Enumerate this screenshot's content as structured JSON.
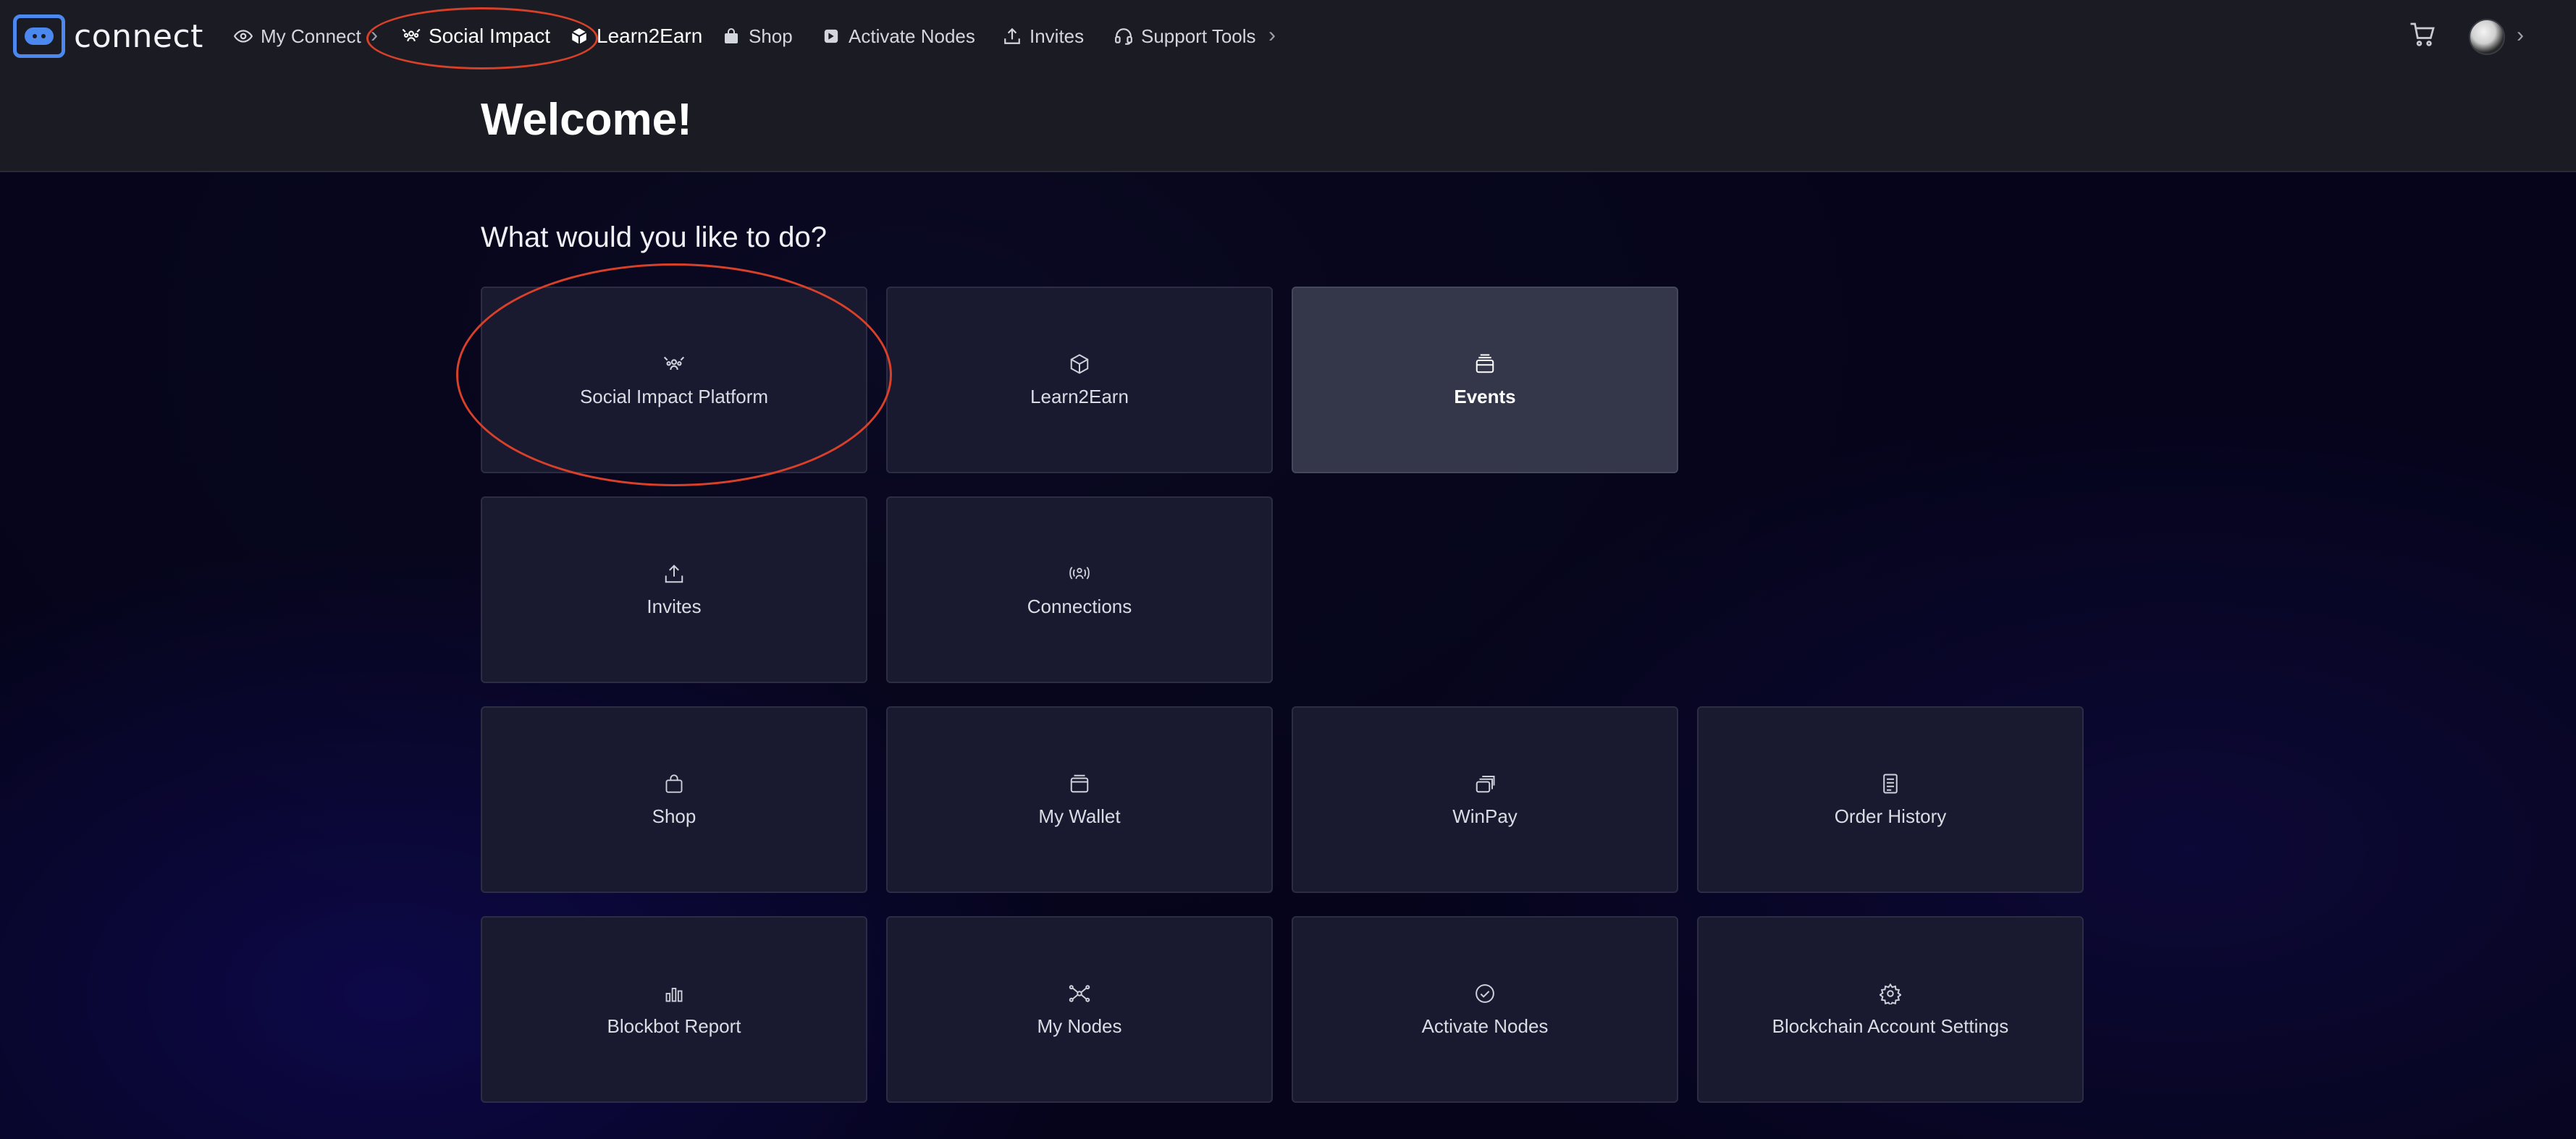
{
  "brand": {
    "name": "connect",
    "color": "#4b88f0"
  },
  "nav": {
    "items": [
      {
        "label": "My Connect",
        "icon": "eye-icon"
      },
      {
        "label": "Social Impact",
        "icon": "social-impact-icon"
      },
      {
        "label": "Learn2Earn",
        "icon": "cube-icon"
      },
      {
        "label": "Shop",
        "icon": "bag-icon"
      },
      {
        "label": "Activate Nodes",
        "icon": "node-badge-icon"
      },
      {
        "label": "Invites",
        "icon": "upload-icon"
      },
      {
        "label": "Support Tools",
        "icon": "headset-icon"
      }
    ]
  },
  "header": {
    "title": "Welcome!"
  },
  "main": {
    "question": "What would you like to do?",
    "tiles": [
      {
        "label": "Social Impact Platform",
        "icon": "social-impact-icon"
      },
      {
        "label": "Learn2Earn",
        "icon": "cube-icon"
      },
      {
        "label": "Events",
        "icon": "calendar-stack-icon",
        "active": true
      },
      {
        "label": "Invites",
        "icon": "upload-icon"
      },
      {
        "label": "Connections",
        "icon": "connections-icon"
      },
      {
        "label": "Shop",
        "icon": "bag-icon"
      },
      {
        "label": "My Wallet",
        "icon": "wallet-icon"
      },
      {
        "label": "WinPay",
        "icon": "coins-stack-icon"
      },
      {
        "label": "Order History",
        "icon": "receipt-icon"
      },
      {
        "label": "Blockbot Report",
        "icon": "bar-chart-icon"
      },
      {
        "label": "My Nodes",
        "icon": "network-icon"
      },
      {
        "label": "Activate Nodes",
        "icon": "check-circle-icon"
      },
      {
        "label": "Blockchain Account Settings",
        "icon": "gear-icon"
      }
    ]
  },
  "colors": {
    "annotation": "#d9402a",
    "header_bg": "#1b1c23",
    "tile_bg": "#191a30",
    "tile_active_bg": "#34364a"
  }
}
